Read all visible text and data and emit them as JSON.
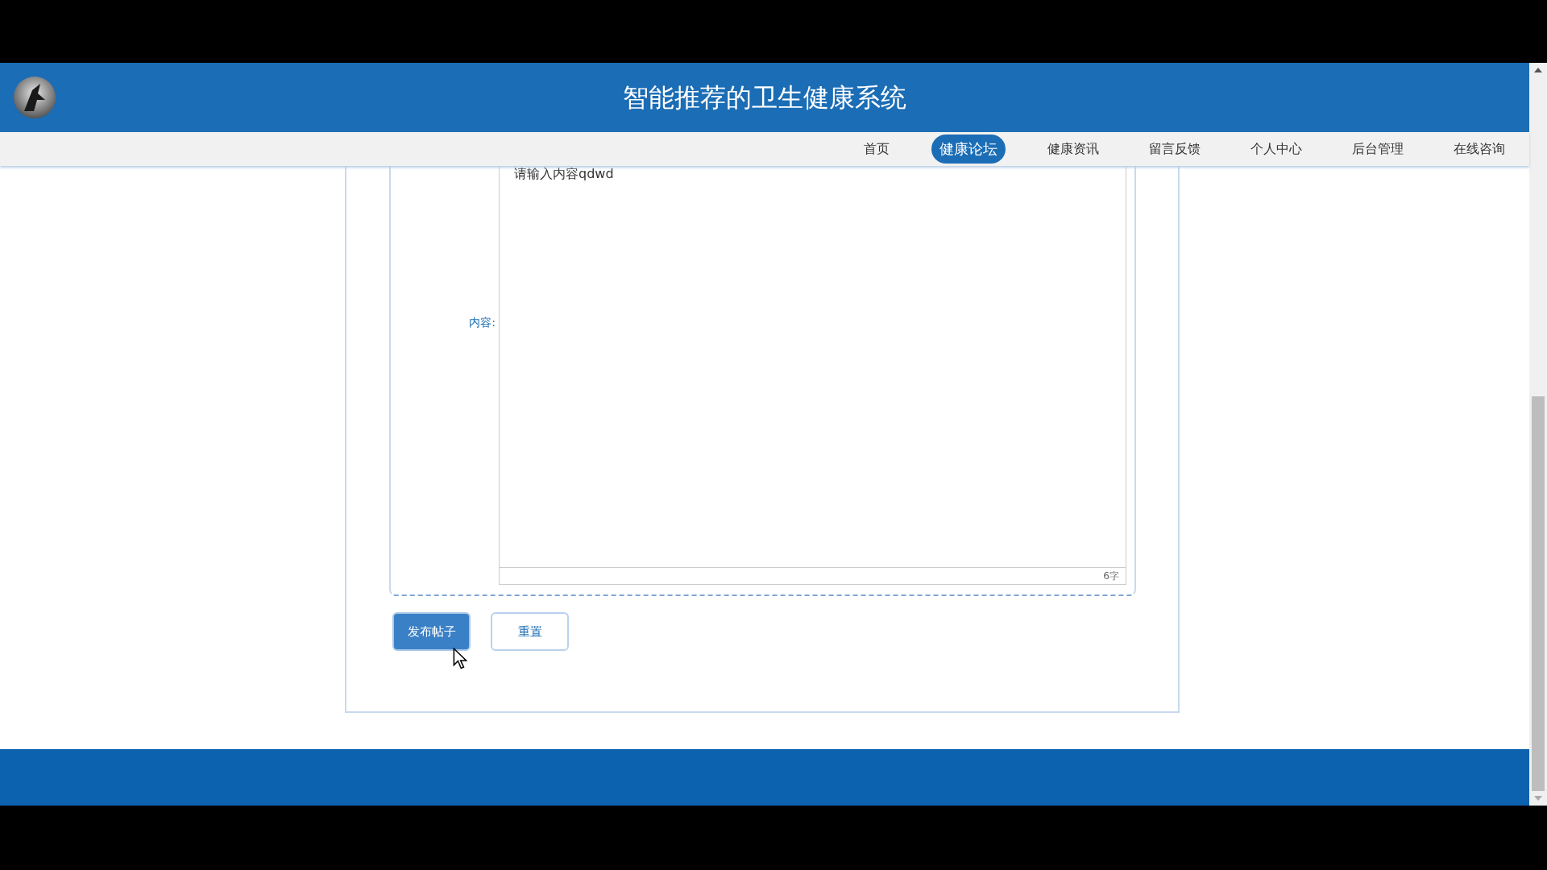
{
  "header": {
    "title": "智能推荐的卫生健康系统"
  },
  "nav": [
    {
      "label": "首页",
      "selected": false
    },
    {
      "label": "健康论坛",
      "selected": true
    },
    {
      "label": "健康资讯",
      "selected": false
    },
    {
      "label": "留言反馈",
      "selected": false
    },
    {
      "label": "个人中心",
      "selected": false
    },
    {
      "label": "后台管理",
      "selected": false
    },
    {
      "label": "在线咨询",
      "selected": false
    }
  ],
  "form": {
    "field_label": "内容:",
    "content": "请输入内容qdwd",
    "word_count": "6字"
  },
  "buttons": [
    {
      "label": "发布帖子",
      "kind": "primary"
    },
    {
      "label": "重置",
      "kind": "secondary"
    }
  ]
}
